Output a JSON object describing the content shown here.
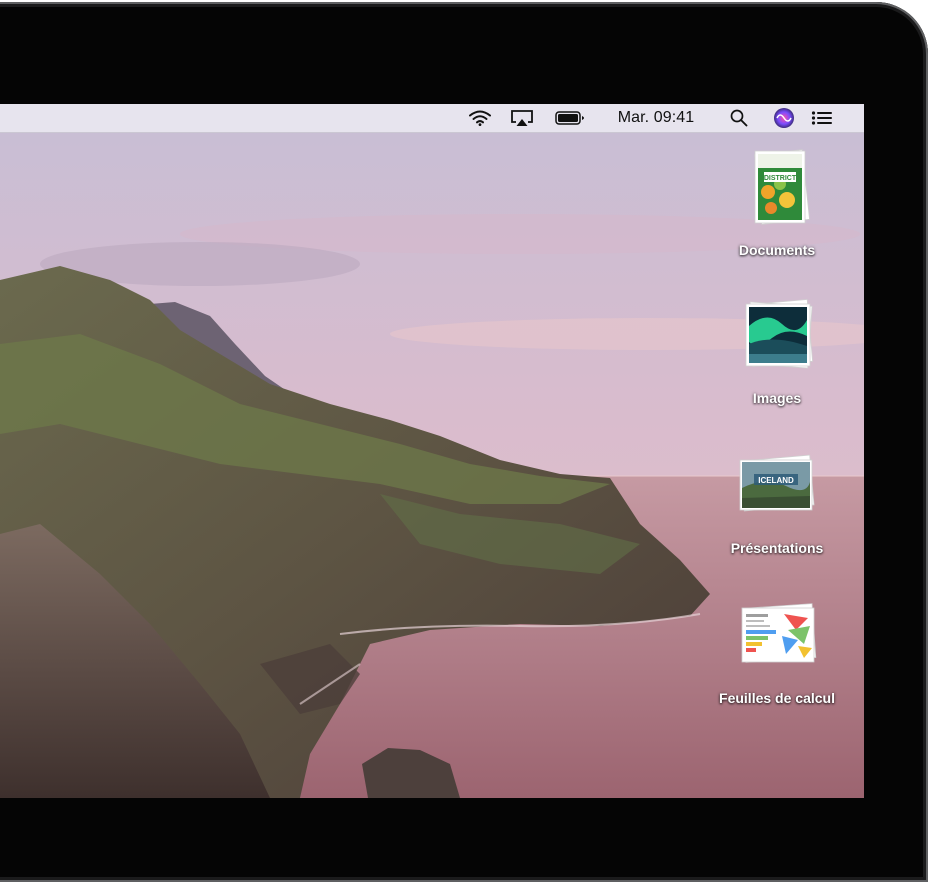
{
  "menubar": {
    "clock": "Mar. 09:41",
    "icons": [
      "wifi-icon",
      "airplay-icon",
      "battery-icon",
      "spotlight-search-icon",
      "siri-icon",
      "notification-center-icon"
    ]
  },
  "desktop": {
    "stacks": [
      {
        "label": "Documents",
        "icon": "documents-stack-icon",
        "thumbnail_text": "DISTRICT"
      },
      {
        "label": "Images",
        "icon": "images-stack-icon"
      },
      {
        "label": "Présentations",
        "icon": "presentations-stack-icon",
        "thumbnail_text": "ICELAND"
      },
      {
        "label": "Feuilles de calcul",
        "icon": "spreadsheets-stack-icon"
      }
    ]
  },
  "colors": {
    "menubar": "#eae6f0",
    "sky_top": "#c9bfd6",
    "sky_bottom": "#e2bcc4",
    "sea": "#b07a84",
    "siri_accent": "#7a4cff"
  }
}
